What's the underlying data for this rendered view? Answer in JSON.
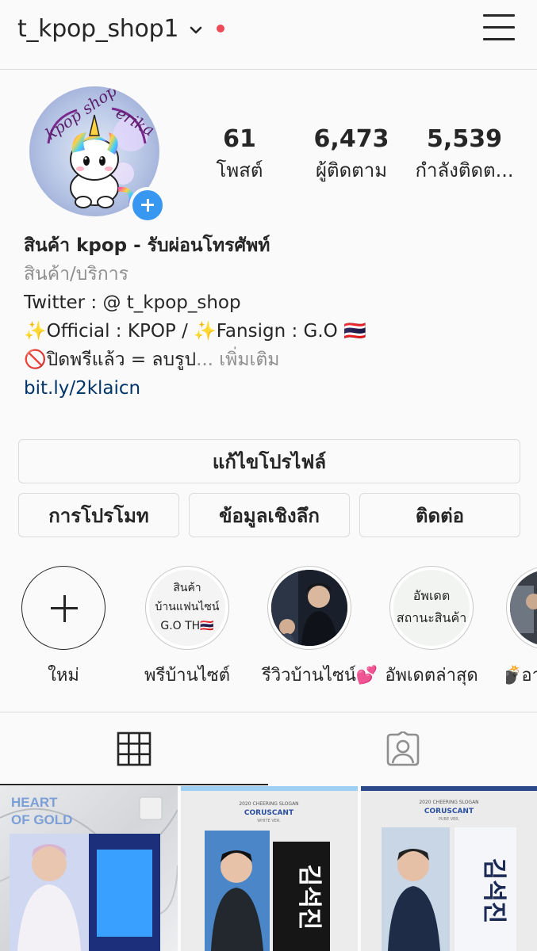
{
  "header": {
    "username": "t_kpop_shop1",
    "notification_dot_color": "#ed4956"
  },
  "profile": {
    "avatar_text": "kpop shop erika",
    "stats": [
      {
        "value": "61",
        "label": "โพสต์"
      },
      {
        "value": "6,473",
        "label": "ผู้ติดตาม"
      },
      {
        "value": "5,539",
        "label": "กำลังติดต..."
      }
    ]
  },
  "bio": {
    "name": "สินค้า kpop - รับผ่อนโทรศัพท์",
    "category": "สินค้า/บริการ",
    "line1": "Twitter : @ t_kpop_shop",
    "line2": "✨Official : KPOP / ✨Fansign : G.O 🇹🇭",
    "line3": "🚫ปิดพรีแล้ว = ลบรูป",
    "more": "... เพิ่มเติม",
    "link": "bit.ly/2klaicn"
  },
  "buttons": {
    "edit_profile": "แก้ไขโปรไฟล์",
    "promotions": "การโปรโมท",
    "insights": "ข้อมูลเชิงลึก",
    "contact": "ติดต่อ"
  },
  "highlights": [
    {
      "label": "ใหม่"
    },
    {
      "label": "พรีบ้านไซต์",
      "cover_lines": [
        "สินค้า",
        "บ้านแฟนไซน์",
        "G.O TH🇹🇭"
      ]
    },
    {
      "label": "รีวิวบ้านไซน์💕"
    },
    {
      "label": "อัพเดตล่าสุด",
      "cover_lines": [
        "อัพเดต",
        "สถานะสินค้า"
      ]
    },
    {
      "label": "💣อา"
    }
  ],
  "tabs": [
    {
      "icon": "grid-icon",
      "active": true
    },
    {
      "icon": "tagged-icon",
      "active": false
    }
  ],
  "posts": [
    {
      "title": "HEART OF GOLD"
    },
    {
      "title": "CORUSCANT",
      "small": "2020 CHEERING SLOGAN",
      "ver": "WHITE VER."
    },
    {
      "title": "CORUSCANT",
      "small": "2020 CHEERING SLOGAN",
      "ver": "PURE VER."
    }
  ]
}
